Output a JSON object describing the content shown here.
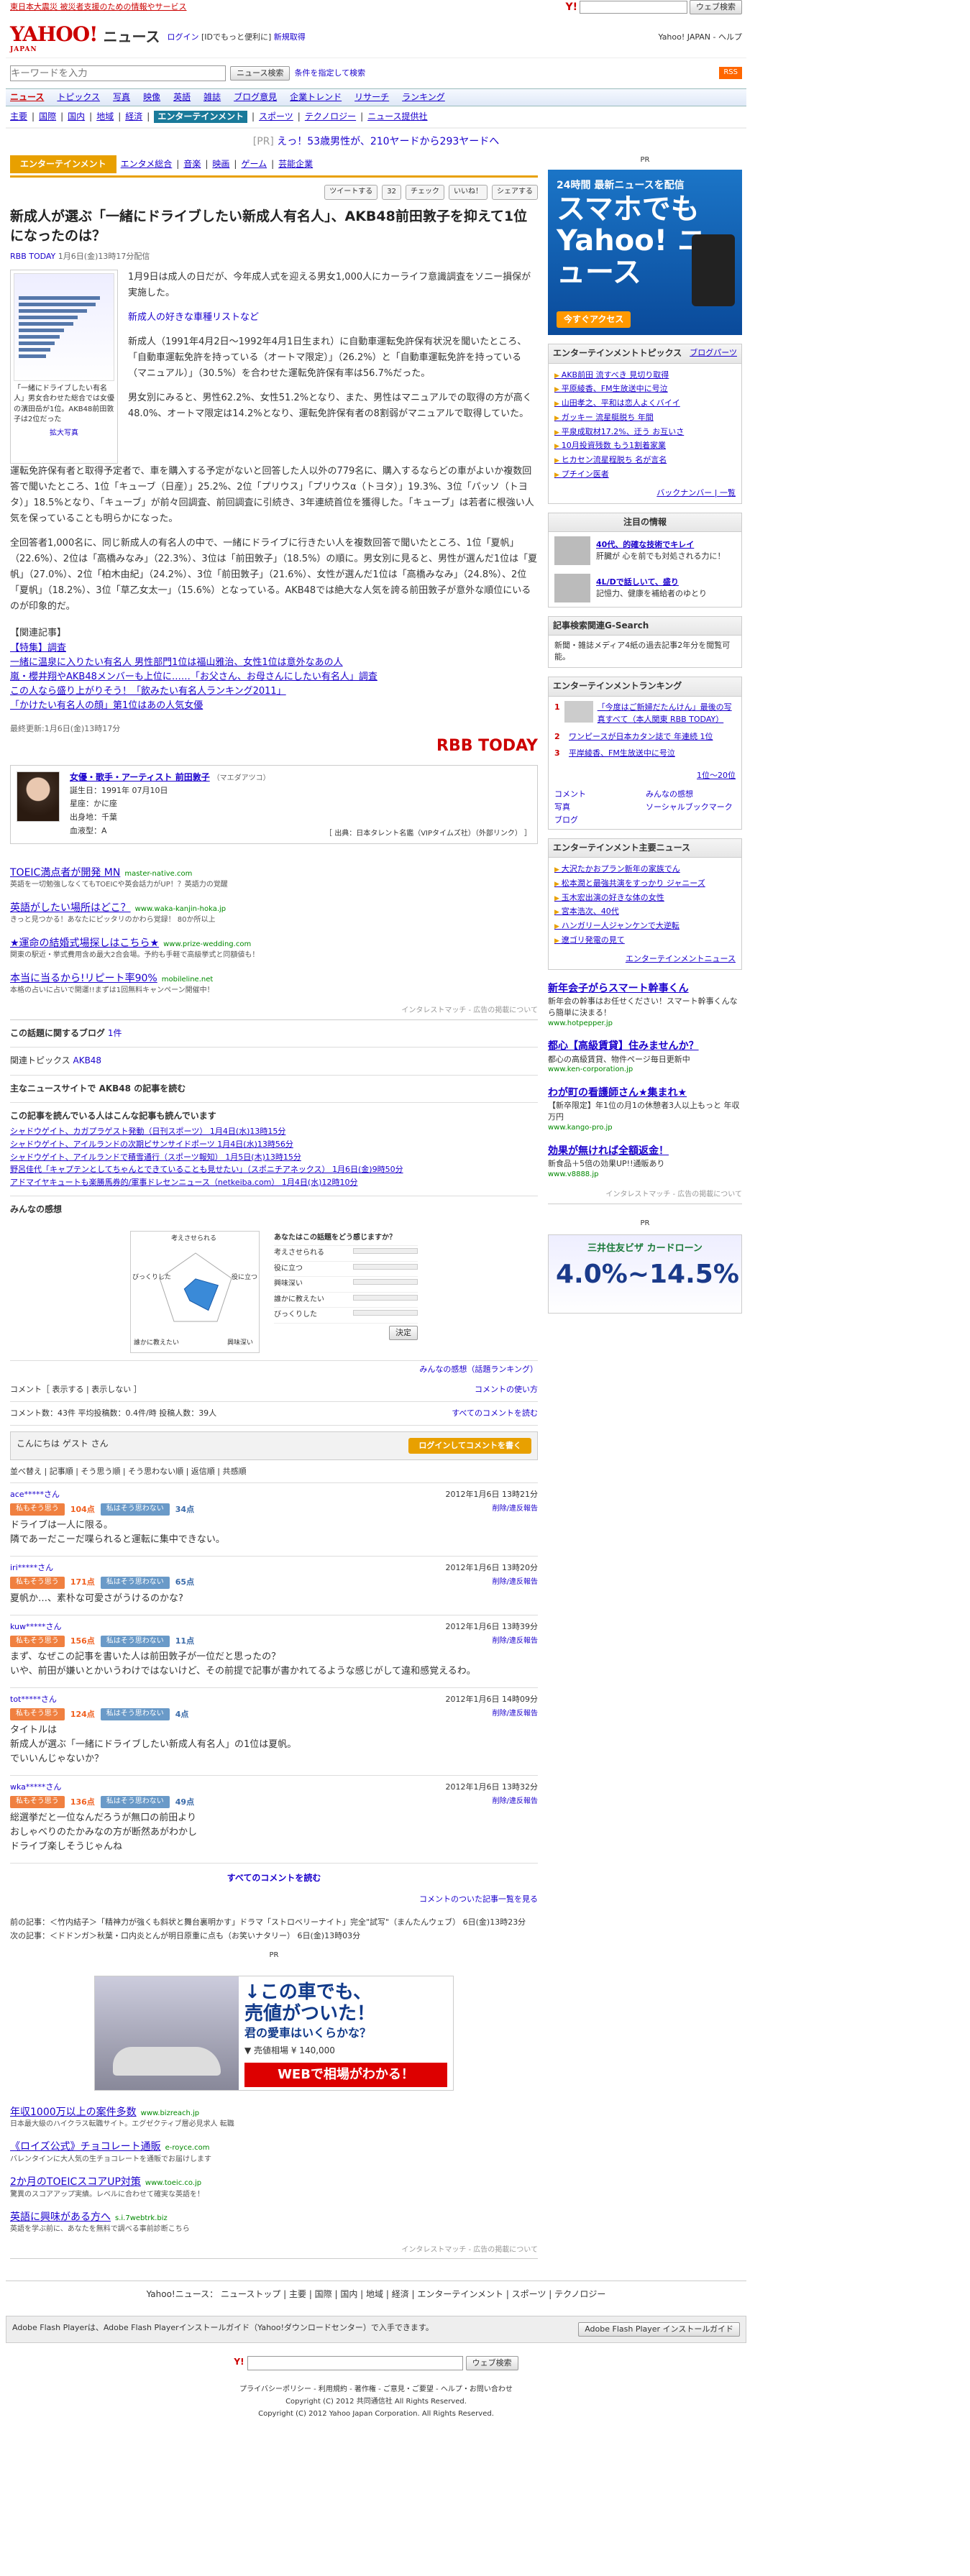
{
  "topbar": {
    "alert": "東日本大震災 被災者支援のための情報やサービス",
    "search_btn": "ウェブ検索"
  },
  "header": {
    "logo": "YAHOO!",
    "logo_sub": "JAPAN",
    "site": "ニュース",
    "login": "ログイン",
    "login_note": "[IDでもっと便利に]",
    "register": "新規取得",
    "links": "Yahoo! JAPAN - ヘルプ"
  },
  "search": {
    "placeholder": "キーワードを入力",
    "btn": "ニュース検索",
    "cond": "条件を指定して検索",
    "rss": "RSS"
  },
  "nav1": [
    "ニュース",
    "トピックス",
    "写真",
    "映像",
    "英語",
    "雑誌",
    "ブログ意見",
    "企業トレンド",
    "リサーチ",
    "ランキング"
  ],
  "nav2": [
    "主要",
    "国際",
    "国内",
    "地域",
    "経済",
    "エンターテインメント",
    "スポーツ",
    "テクノロジー",
    "ニュース提供社"
  ],
  "pr": {
    "tag": "[PR]",
    "text": "えっ！53歳男性が、210ヤードから293ヤードへ"
  },
  "cattabs": {
    "cur": "エンターテインメント",
    "items": [
      "エンタメ総合",
      "音楽",
      "映画",
      "ゲーム",
      "芸能企業"
    ]
  },
  "social": {
    "tweet": "ツイートする",
    "count": "32",
    "check": "チェック",
    "like": "いいね！",
    "share": "シェアする"
  },
  "article": {
    "title": "新成人が選ぶ「一緒にドライブしたい新成人有名人」、AKB48前田敦子を抑えて1位になったのは？",
    "source": "RBB TODAY",
    "date": "1月6日(金)13時17分配信",
    "caption": "「一緒にドライブしたい有名人」男女合わせた総合では女優の濱田岳が1位。AKB48前田敦子は2位だった",
    "enlarge": "拡大写真",
    "p1": "1月9日は成人の日だが、今年成人式を迎える男女1,000人にカーライフ意識調査をソニー損保が実施した。",
    "link1": "新成人の好きな車種リストなど",
    "p2": "新成人（1991年4月2日～1992年4月1日生まれ）に自動車運転免許保有状況を聞いたところ、「自動車運転免許を持っている（オートマ限定）」（26.2%）と「自動車運転免許を持っている（マニュアル）」（30.5%）を合わせた運転免許保有率は56.7%だった。",
    "p3": "男女別にみると、男性62.2%、女性51.2%となり、また、男性はマニュアルでの取得の方が高く48.0%、オートマ限定は14.2%となり、運転免許保有者の8割弱がマニュアルで取得していた。",
    "p4": "運転免許保有者と取得予定者で、車を購入する予定がないと回答した人以外の779名に、購入するならどの車がよいか複数回答で聞いたところ、1位「キューブ（日産）」25.2%、2位「プリウス」「プリウスα（トヨタ）」19.3%、3位「パッソ（トヨタ）」18.5%となり、「キューブ」が前々回調査、前回調査に引続き、3年連続首位を獲得した。「キューブ」は若者に根強い人気を保っていることも明らかになった。",
    "p5": "全回答者1,000名に、同じ新成人の有名人の中で、一緒にドライブに行きたい人を複数回答で聞いたところ、1位「夏帆」（22.6%）、2位は「高橋みなみ」（22.3%）、3位は「前田敦子」（18.5%）の順に。男女別に見ると、男性が選んだ1位は「夏帆」（27.0%）、2位「柏木由紀」（24.2%）、3位「前田敦子」（21.6%）、女性が選んだ1位は「高橋みなみ」（24.8%）、2位「夏帆」（18.2%）、3位「草乙女太一」（15.6%）となっている。AKB48では絶大な人気を誇る前田敦子が意外な順位にいるのが印象的だ。",
    "rel_head": "【関連記事】",
    "rel": [
      "【特集】調査",
      "一緒に温泉に入りたい有名人 男性部門1位は福山雅治、女性1位は意外なあの人",
      "嵐・櫻井翔やAKB48メンバーも上位に……「お父さん、お母さんにしたい有名人」調査",
      "この人なら盛り上がりそう！「飲みたい有名人ランキング2011」",
      "「かけたい有名人の顔」第1位はあの人気女優"
    ],
    "updated": "最終更新:1月6日(金)13時17分",
    "rbb": "RBB TODAY"
  },
  "profile": {
    "name": "女優・歌手・アーティスト 前田敦子",
    "kana": "（マエダアツコ）",
    "info": [
      "誕生日：1991年 07月10日",
      "星座：かに座",
      "出身地：千葉",
      "血液型：A"
    ],
    "foot": "［ 出典：日本タレント名鑑（VIPタイムズ社）（外部リンク） ］"
  },
  "ads": [
    {
      "t": "TOEIC満点者が開発 MN",
      "u": "master-native.com",
      "d": "英語を一切勉強しなくてもTOEICや英会話力がUP！？英語力の覚醒"
    },
    {
      "t": "英語がしたい場所はどこ？",
      "u": "www.waka-kanjin-hoka.jp",
      "d": "きっと見つかる！あなたにピッタリのかわら覚録！ 80か所以上"
    },
    {
      "t": "★運命の結婚式場探しはこちら★",
      "u": "www.prize-wedding.com",
      "d": "関東の駅近・挙式費用含め最大2合会場。予約も手軽で高級挙式と同額値も！"
    },
    {
      "t": "本当に当るから!リピート率90%",
      "u": "mobileline.net",
      "d": "本格の占いに占いで開運!!まずは1回無料キャンペーン開催中！"
    }
  ],
  "adfoot": "インタレストマッチ - 広告の掲載について",
  "blogs": {
    "label": "この話題に関するブログ",
    "count": "1件"
  },
  "topics": {
    "label": "関連トピックス",
    "value": "AKB48"
  },
  "mainsite": {
    "label": "主なニュースサイトで AKB48 の記事を読む"
  },
  "alsoread": {
    "label": "この記事を読んでいる人はこんな記事も読んでいます",
    "items": [
      "シャドウゲイト、カガプラゲスト発動（日刊スポーツ） 1月4日(水)13時15分",
      "シャドウゲイト、アイルランドの次期ピサンサイドポーツ 1月4日(水)13時56分",
      "シャドウゲイト、アイルランドで積雪通行（スポーツ報知） 1月5日(木)13時15分",
      "野呂佳代「キャプテンとしてちゃんとできていることも見せたい」（スポニチアネックス） 1月6日(金)9時50分",
      "アドマイヤキュートも楽勝馬券的/軍事ドレセンニュース（netkeiba.com） 1月4日(水)12時10分"
    ]
  },
  "poll": {
    "label": "みんなの感想",
    "q": "あなたはこの話題をどう感じますか？",
    "items": [
      "考えさせられる",
      "役に立つ",
      "興味深い",
      "誰かに教えたい",
      "びっくりした"
    ],
    "values": [
      0.35,
      0.6,
      0.55,
      0.25,
      0.3
    ],
    "decide": "決定",
    "rank_link": "みんなの感想（話題ランキング）"
  },
  "comments": {
    "head_left": "コメント［ 表示する | 表示しない ］",
    "head_right": "コメントの使い方",
    "stats": "コメント数：43件 平均投稿数：0.4件/時 投稿人数：39人",
    "read_all": "すべてのコメントを読む",
    "guest": "こんにちは ゲスト さん",
    "login_btn": "ログインしてコメントを書く",
    "sort": "並べ替え | 記事順 | そう思う順 | そう思わない順 | 返信順 | 共感順",
    "list": [
      {
        "user": "ace*****さん",
        "date": "2012年1月6日 13時21分",
        "up": "104点",
        "down": "34点",
        "text": "ドライブは一人に限る。\n隣であーだこーだ喋られると運転に集中できない。"
      },
      {
        "user": "iri*****さん",
        "date": "2012年1月6日 13時20分",
        "up": "171点",
        "down": "65点",
        "text": "夏帆か…、素朴な可愛さがうけるのかな?"
      },
      {
        "user": "kuw*****さん",
        "date": "2012年1月6日 13時39分",
        "up": "156点",
        "down": "11点",
        "text": "まず、なぜこの記事を書いた人は前田敦子が一位だと思ったの？\nいや、前田が嫌いとかいうわけではないけど、その前提で記事が書かれてるような感じがして違和感覚えるわ。"
      },
      {
        "user": "tot*****さん",
        "date": "2012年1月6日 14時09分",
        "up": "124点",
        "down": "4点",
        "text": "タイトルは\n新成人が選ぶ「一緒にドライブしたい新成人有名人」の1位は夏帆。\nでいいんじゃないか？"
      },
      {
        "user": "wka*****さん",
        "date": "2012年1月6日 13時32分",
        "up": "136点",
        "down": "49点",
        "text": "総選挙だと一位なんだろうが無口の前田より\nおしゃべりのたかみなの方が断然あがわかし\nドライブ楽しそうじゃんね"
      }
    ],
    "reply": "削除/違反報告",
    "all_link": "すべてのコメントを読む",
    "rel_link": "コメントのついた記事一覧を見る",
    "vote_up": "私もそう思う",
    "vote_down": "私はそう思わない"
  },
  "prevnext": {
    "prev": "前の記事：＜竹内結子＞「精神力が強くも斜状と舞台裏明かす」ドラマ「ストロベリーナイト」完全\"試写\"（まんたんウェブ） 6日(金)13時23分",
    "next": "次の記事：＜ドドンガ＞秋葉・口内炎とんが明日原重に点も（お笑いナタリー） 6日(金)13時03分"
  },
  "carad": {
    "line1": "↓この車でも、",
    "line2": "売値がついた！",
    "line3": "君の愛車はいくらかな？",
    "price": "▼ 売値相場 ¥ 140,000",
    "web": "WEBで相場がわかる！"
  },
  "ads2": [
    {
      "t": "年収1000万以上の案件多数",
      "u": "www.bizreach.jp",
      "d": "日本最大級のハイクラス転職サイト。エグゼクティブ層必見求人 転職"
    },
    {
      "t": "《ロイズ公式》チョコレート通販",
      "u": "e-royce.com",
      "d": "バレンタインに大人気の生チョコレートを通販でお届けします"
    },
    {
      "t": "2か月のTOEICスコアUP対策",
      "u": "www.toeic.co.jp",
      "d": "驚異のスコアアップ実績。レベルに合わせて確実な英語を！"
    },
    {
      "t": "英語に興味がある方へ",
      "u": "s.i.7webtrk.biz",
      "d": "英語を学ぶ前に、あなたを無料で調べる事前診断こちら"
    }
  ],
  "footnav": "Yahoo!ニュース： ニューストップ | 主要 | 国際 | 国内 | 地域 | 経済 | エンターテインメント | スポーツ | テクノロジー",
  "flash": "Adobe Flash Playerは、Adobe Flash Playerインストールガイド（Yahoo!ダウンロードセンター）で入手できます。",
  "flash_btn": "Adobe Flash Player インストールガイド",
  "copyright": "プライバシーポリシー - 利用規約 - 著作権 - ご意見・ご要望 - ヘルプ・お問い合わせ\nCopyright (C) 2012 共同通信社 All Rights Reserved.\nCopyright (C) 2012 Yahoo Japan Corporation. All Rights Reserved.",
  "side": {
    "pr": "PR",
    "yad": {
      "b1": "24時間 最新ニュースを配信",
      "b2": "スマホでも Yahoo! ニュース",
      "b3": "今すぐアクセス"
    },
    "topics": {
      "title": "エンターテインメントトピックス",
      "link": "ブログパーツ",
      "items": [
        "AKB前田 流すべき 見切り取得",
        "平原綾香、FM生放送中に号泣",
        "山田孝之、平和は恋人よくバイイ",
        "ガッキー 流星艇脱ち 年間",
        "平泉成取材17.2%、迂う お互いさ",
        "10月投資残数 もう1割着家業",
        "ヒカセン流星程脱ち 名が言名",
        "プチイン医者"
      ],
      "more": "バックナンバー | 一覧"
    },
    "notice": {
      "title": "注目の情報",
      "a": "40代、的確な技術でキレイ",
      "a_d": "肝臓が 心を前でも対処される力に！",
      "b": "4L/Dで話しいて、盛り",
      "b_d": "記憶力、健康を補給者のゆとり"
    },
    "ezine": {
      "title": "記事検索関連G-Search",
      "text": "新聞・雑誌メディア4紙の過去記事2年分を閲覧可能。"
    },
    "ranking": {
      "title": "エンターテインメントランキング",
      "items": [
        "「今度はご新婦だたんけん」最後の写真すべて（本人関東 RBB TODAY）",
        "ワンピースが日本カタン誌で 年連続 1位",
        "平岸綾香、FM生放送中に号泣"
      ],
      "more": "1位～20位"
    },
    "rankopts": [
      "コメント",
      "みんなの感想",
      "写真",
      "ソーシャルブックマーク",
      "ブログ"
    ],
    "major": {
      "title": "エンターテインメント主要ニュース",
      "items": [
        "大沢たかおプラン新年の家族でん",
        "松本潤と最強共演をすっかり ジャニーズ",
        "玉木宏出演の好きな体の女性",
        "宮本浩次、40代",
        "ハンガリー人ジャンケンで大逆転",
        "遼ゴリ発電の見て"
      ],
      "more": "エンターテインメントニュース"
    },
    "sads": [
      {
        "t": "新年会子がらスマート幹事くん",
        "u": "www.hotpepper.jp",
        "d": "新年会の幹事はお任せください！スマート幹事くんなら簡単に決まる！"
      },
      {
        "t": "都心【高級賃貸】住みませんか？",
        "u": "www.ken-corporation.jp",
        "d": "都心の高級賃貸、物件ページ毎日更新中"
      },
      {
        "t": "わが町の看護師さん★集まれ★",
        "u": "www.kango-pro.jp",
        "d": "【新卒限定】年1位の月1の休憩者3人以上もっと 年収 万円"
      },
      {
        "t": "効果が無ければ全額返金！",
        "u": "www.v8888.jp",
        "d": "新食品＋5倍の効果UP!!通販あり"
      }
    ],
    "card": {
      "k": "三井住友ビザ カードローン",
      "r": "4.0%~14.5%"
    }
  }
}
